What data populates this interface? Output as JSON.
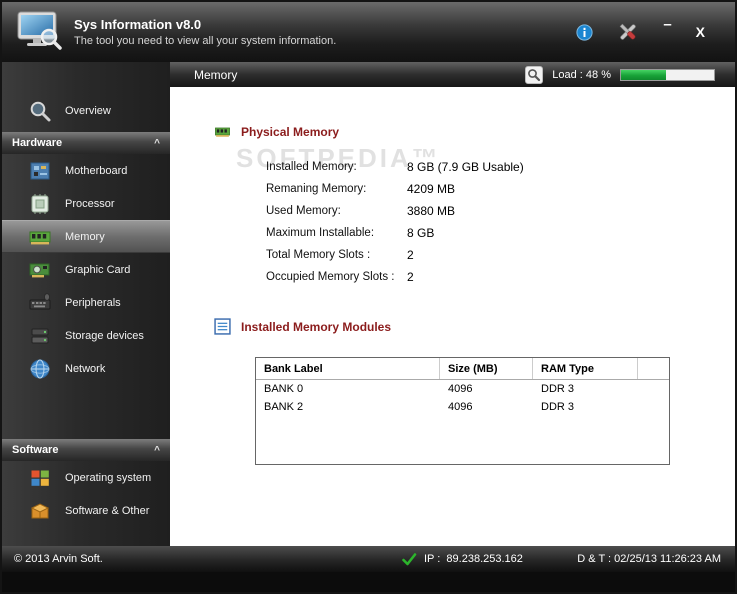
{
  "titlebar": {
    "title": "Sys Information v8.0",
    "subtitle": "The tool you need to view all your system information.",
    "minimize_label": "–",
    "close_label": "X"
  },
  "sidebar": {
    "overview_label": "Overview",
    "hardware_header": "Hardware",
    "hardware_items": [
      "Motherboard",
      "Processor",
      "Memory",
      "Graphic Card",
      "Peripherals",
      "Storage devices",
      "Network"
    ],
    "software_header": "Software",
    "software_items": [
      "Operating system",
      "Software & Other"
    ],
    "collapse_glyph": "^"
  },
  "main": {
    "header_title": "Memory",
    "load_label": "Load : 48 %",
    "load_percent": 48
  },
  "physical_memory": {
    "title": "Physical Memory",
    "rows": [
      {
        "label": "Installed Memory:",
        "value": "8 GB (7.9 GB Usable)"
      },
      {
        "label": "Remaning Memory:",
        "value": "4209 MB"
      },
      {
        "label": "Used Memory:",
        "value": "3880 MB"
      },
      {
        "label": "Maximum Installable:",
        "value": "8 GB"
      },
      {
        "label": "Total Memory Slots :",
        "value": "2"
      },
      {
        "label": "Occupied Memory Slots :",
        "value": "2"
      }
    ]
  },
  "memory_modules": {
    "title": "Installed Memory Modules",
    "columns": [
      "Bank Label",
      "Size (MB)",
      "RAM Type"
    ],
    "rows": [
      [
        "BANK 0",
        "4096",
        "DDR 3"
      ],
      [
        "BANK 2",
        "4096",
        "DDR 3"
      ]
    ]
  },
  "watermark": "SOFTPEDIA™",
  "statusbar": {
    "copyright": "© 2013 Arvin Soft.",
    "ip": "IP :  89.238.253.162",
    "datetime": "D & T : 02/25/13 11:26:23 AM"
  },
  "colors": {
    "load_bar_fill": "#18a238",
    "section_title": "#8b1c1c",
    "status_ok_check": "#2cb52c",
    "info_icon": "#1c86d1",
    "selected_item_highlight": "#8f8f8f"
  }
}
